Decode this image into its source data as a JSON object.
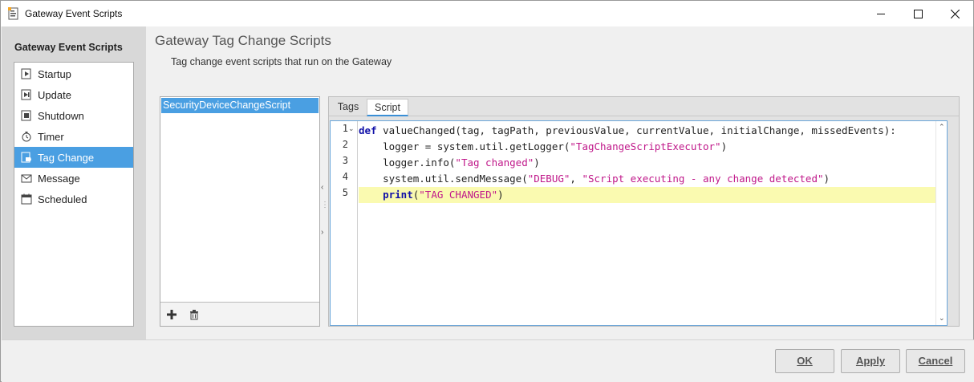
{
  "window": {
    "title": "Gateway Event Scripts"
  },
  "nav": {
    "header": "Gateway Event Scripts",
    "items": [
      {
        "label": "Startup",
        "icon": "startup-icon"
      },
      {
        "label": "Update",
        "icon": "update-icon"
      },
      {
        "label": "Shutdown",
        "icon": "shutdown-icon"
      },
      {
        "label": "Timer",
        "icon": "timer-icon"
      },
      {
        "label": "Tag Change",
        "icon": "tag-change-icon",
        "selected": true
      },
      {
        "label": "Message",
        "icon": "message-icon"
      },
      {
        "label": "Scheduled",
        "icon": "scheduled-icon"
      }
    ]
  },
  "content": {
    "title": "Gateway Tag Change Scripts",
    "subtitle": "Tag change event scripts that run on the Gateway",
    "scripts": [
      "SecurityDeviceChangeScript"
    ],
    "tabs": [
      "Tags",
      "Script"
    ],
    "active_tab": "Script"
  },
  "editor": {
    "line_numbers": [
      "1",
      "2",
      "3",
      "4",
      "5"
    ],
    "lines": [
      "def valueChanged(tag, tagPath, previousValue, currentValue, initialChange, missedEvents):",
      "\tlogger = system.util.getLogger(\"TagChangeScriptExecutor\")",
      "\tlogger.info(\"Tag changed\")",
      "\tsystem.util.sendMessage(\"DEBUG\", \"Script executing - any change detected\")",
      "\tprint(\"TAG CHANGED\")"
    ],
    "highlighted_line": 5
  },
  "buttons": {
    "ok": "OK",
    "apply": "Apply",
    "cancel": "Cancel"
  },
  "colors": {
    "selection": "#4a9fe2",
    "keyword": "#1010a8",
    "string": "#c0188a",
    "line_highlight": "#fafab0"
  }
}
